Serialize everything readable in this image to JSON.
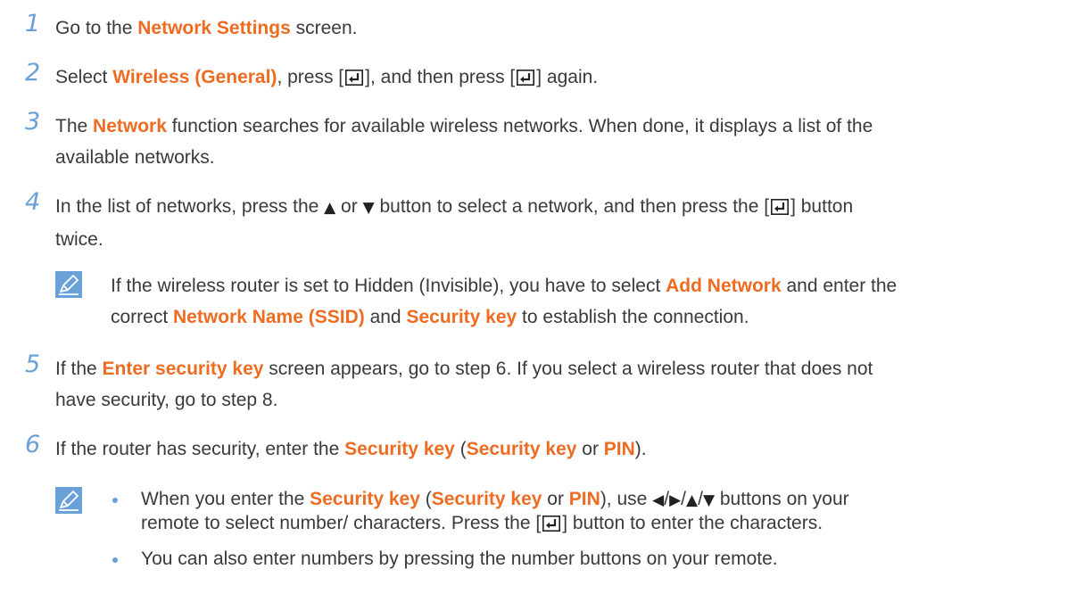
{
  "colors": {
    "step_number": "#6aa0d8",
    "highlight": "#ee6b22",
    "body_text": "#3a3a3a",
    "note_icon_bg": "#6aa0d8"
  },
  "icons": {
    "enter": "enter-key-icon",
    "note": "note-pencil-icon",
    "up": "▲",
    "down": "▼",
    "left": "◀",
    "right": "▶"
  },
  "steps": [
    {
      "number": "1",
      "t1": "Go to the ",
      "h1": "Network Settings",
      "t2": " screen."
    },
    {
      "number": "2",
      "t1": "Select ",
      "h1": "Wireless (General)",
      "t2": ", press [",
      "t3": "], and then press [",
      "t4": "] again."
    },
    {
      "number": "3",
      "t1": "The ",
      "h1": "Network",
      "t2": " function searches for available wireless networks. When done, it displays a list of the",
      "t3": "available networks."
    },
    {
      "number": "4",
      "t1": "In the list of networks, press the ",
      "t2": " or ",
      "t3": " button to select a network, and then press the [",
      "t4": "] button",
      "t5": "twice."
    },
    {
      "number": "5",
      "t1": "If the ",
      "h1": "Enter security key",
      "t2": " screen appears, go to step 6. If you select a wireless router that does not",
      "t3": "have security, go to step 8."
    },
    {
      "number": "6",
      "t1": "If the router has security, enter the ",
      "h1": "Security key",
      "t2": " (",
      "h2": "Security key",
      "t3": " or ",
      "h3": "PIN",
      "t4": ")."
    }
  ],
  "note1": {
    "t1": "If the wireless router is set to Hidden (Invisible), you have to select ",
    "h1": "Add Network",
    "t2": " and enter the",
    "t3": "correct ",
    "h2": "Network Name (SSID)",
    "t4": " and ",
    "h3": "Security key",
    "t5": " to establish the connection."
  },
  "note2": {
    "bullet1": {
      "t1": "When you enter the ",
      "h1": "Security key",
      "t2": " (",
      "h2": "Security key",
      "t3": " or ",
      "h3": "PIN",
      "t4": "), use ",
      "t5": " buttons on your",
      "t6": "remote to select number/ characters. Press the [",
      "t7": "] button to enter the characters."
    },
    "bullet2": {
      "t1": "You can also enter numbers by pressing the number buttons on your remote."
    }
  }
}
